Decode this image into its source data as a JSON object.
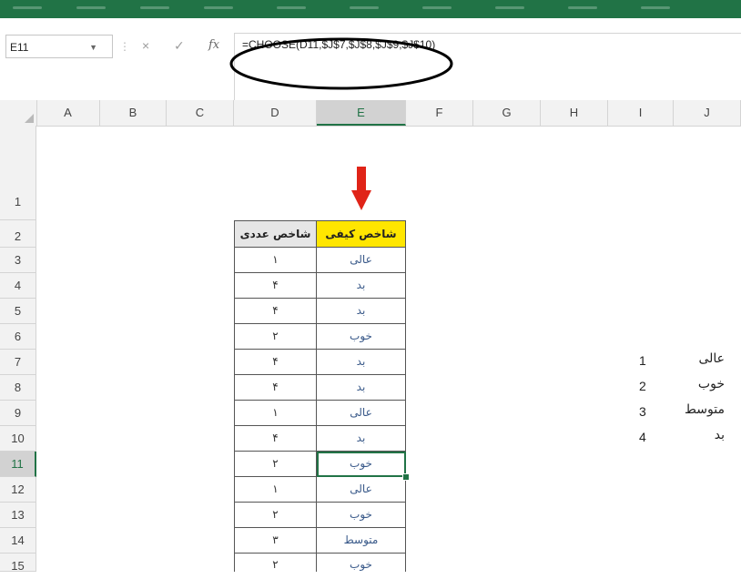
{
  "namebox": {
    "value": "E11"
  },
  "formula_bar": {
    "cancel_icon": "×",
    "enter_icon": "✓",
    "fx_icon": "fx",
    "formula": "=CHOOSE(D11,$J$7,$J$8,$J$9,$J$10)"
  },
  "columns": [
    "A",
    "B",
    "C",
    "D",
    "E",
    "F",
    "G",
    "H",
    "I",
    "J"
  ],
  "selected_column": "E",
  "rows": [
    "1",
    "2",
    "3",
    "4",
    "5",
    "6",
    "7",
    "8",
    "9",
    "10",
    "11",
    "12",
    "13",
    "14",
    "15"
  ],
  "selected_row": "11",
  "table": {
    "header_d": "شاخص عددی",
    "header_e": "شاخص کیفی",
    "header_e_color": "#ffe600",
    "rows": [
      {
        "d": "۱",
        "e": "عالی"
      },
      {
        "d": "۴",
        "e": "بد"
      },
      {
        "d": "۴",
        "e": "بد"
      },
      {
        "d": "۲",
        "e": "خوب"
      },
      {
        "d": "۴",
        "e": "بد"
      },
      {
        "d": "۴",
        "e": "بد"
      },
      {
        "d": "۱",
        "e": "عالی"
      },
      {
        "d": "۴",
        "e": "بد"
      },
      {
        "d": "۲",
        "e": "خوب"
      },
      {
        "d": "۱",
        "e": "عالی"
      },
      {
        "d": "۲",
        "e": "خوب"
      },
      {
        "d": "۳",
        "e": "متوسط"
      },
      {
        "d": "۲",
        "e": "خوب"
      }
    ]
  },
  "lookup": [
    {
      "num": "1",
      "label": "عالی"
    },
    {
      "num": "2",
      "label": "خوب"
    },
    {
      "num": "3",
      "label": "متوسط"
    },
    {
      "num": "4",
      "label": "بد"
    }
  ],
  "colors": {
    "excel_green": "#217346",
    "annotation_arrow": "#e02418"
  }
}
